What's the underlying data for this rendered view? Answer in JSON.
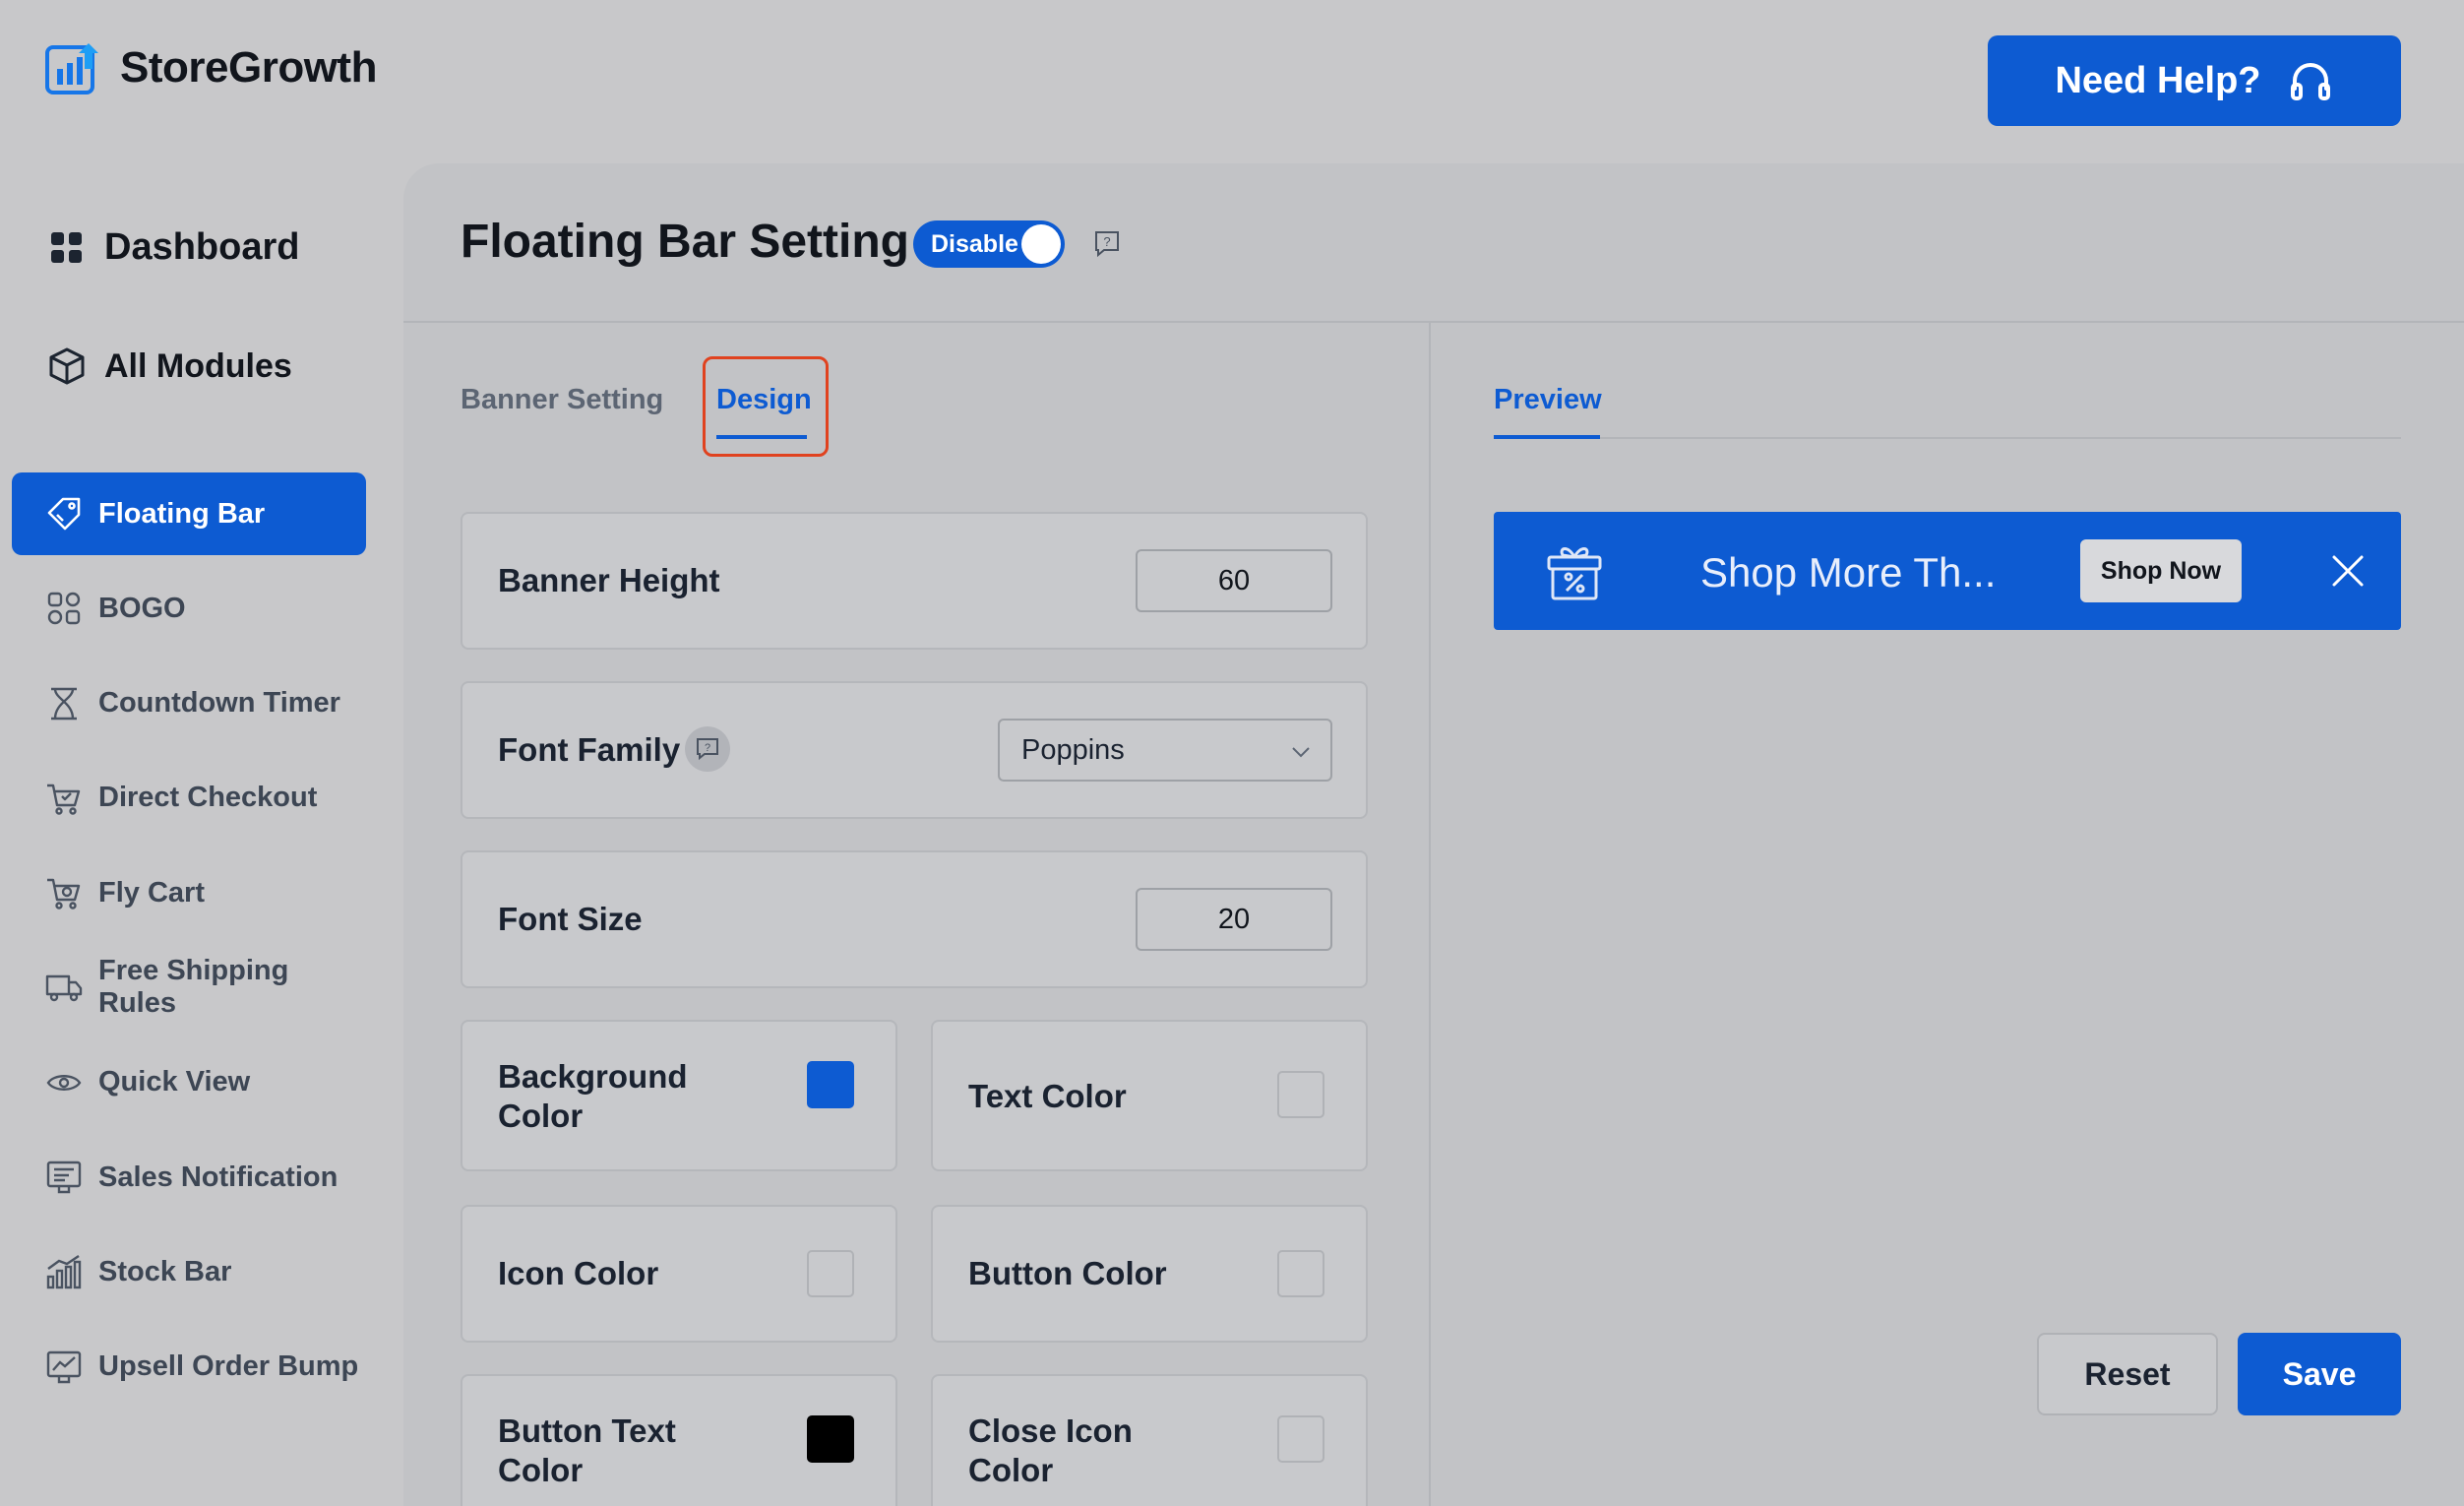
{
  "brand": {
    "name": "StoreGrowth",
    "accent": "#0d5bd2"
  },
  "header": {
    "help_label": "Need Help?"
  },
  "sidebar": {
    "dashboard_label": "Dashboard",
    "all_modules_label": "All Modules",
    "items": [
      {
        "label": "Floating Bar",
        "icon": "tag-icon",
        "active": true
      },
      {
        "label": "BOGO",
        "icon": "bogo-icon",
        "active": false
      },
      {
        "label": "Countdown Timer",
        "icon": "hourglass-icon",
        "active": false
      },
      {
        "label": "Direct Checkout",
        "icon": "cart-check-icon",
        "active": false
      },
      {
        "label": "Fly Cart",
        "icon": "cart-icon",
        "active": false
      },
      {
        "label": "Free Shipping Rules",
        "icon": "truck-icon",
        "active": false
      },
      {
        "label": "Quick View",
        "icon": "eye-icon",
        "active": false
      },
      {
        "label": "Sales Notification",
        "icon": "notification-icon",
        "active": false
      },
      {
        "label": "Stock Bar",
        "icon": "bar-chart-icon",
        "active": false
      },
      {
        "label": "Upsell Order Bump",
        "icon": "trend-icon",
        "active": false
      }
    ]
  },
  "main": {
    "title": "Floating Bar Setting",
    "toggle_label": "Disable",
    "tabs": [
      {
        "label": "Banner Setting",
        "active": false
      },
      {
        "label": "Design",
        "active": true
      }
    ],
    "fields": {
      "banner_height": {
        "label": "Banner Height",
        "value": "60"
      },
      "font_family": {
        "label": "Font Family",
        "value": "Poppins"
      },
      "font_size": {
        "label": "Font Size",
        "value": "20"
      },
      "background_color": {
        "label": "Background Color",
        "color": "#0d5bd2"
      },
      "text_color": {
        "label": "Text Color",
        "color": "#c8c9cc"
      },
      "icon_color": {
        "label": "Icon Color",
        "color": "#c8c9cc"
      },
      "button_color": {
        "label": "Button Color",
        "color": "#c8c9cc"
      },
      "button_text_color": {
        "label": "Button Text Color",
        "color": "#000000"
      },
      "close_icon_color": {
        "label": "Close Icon Color",
        "color": "#c8c9cc"
      }
    },
    "preview": {
      "tab_label": "Preview",
      "banner_text": "Shop More Th...",
      "button_label": "Shop Now"
    },
    "actions": {
      "reset_label": "Reset",
      "save_label": "Save"
    }
  }
}
